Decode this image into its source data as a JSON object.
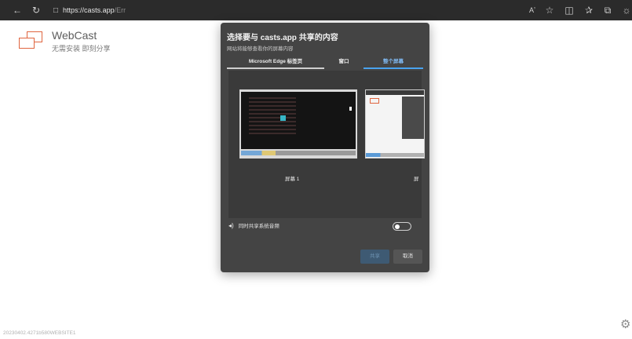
{
  "browser": {
    "url_host": "https://casts.app",
    "url_path": "/Err",
    "read_aloud_label": "Aʼ"
  },
  "page": {
    "brand_title": "WebCast",
    "brand_subtitle": "无需安装 即刻分享",
    "version": "20230402.4271b580WEBSITE1"
  },
  "dialog": {
    "title": "选择要与 casts.app 共享的内容",
    "subtitle": "网站将能够查看你的屏幕内容",
    "tabs": [
      {
        "label": "Microsoft Edge 标签页",
        "active": false
      },
      {
        "label": "窗口",
        "active": false
      },
      {
        "label": "整个屏幕",
        "active": true
      }
    ],
    "screens": [
      {
        "label": "屏幕 1"
      },
      {
        "label": "屏"
      }
    ],
    "audio_label": "同时共享系统音频",
    "audio_enabled": false,
    "share_button": "共享",
    "cancel_button": "取消"
  },
  "colors": {
    "accent": "#4aa3ef",
    "brand": "#e0653f",
    "dialog_bg": "#444444"
  }
}
